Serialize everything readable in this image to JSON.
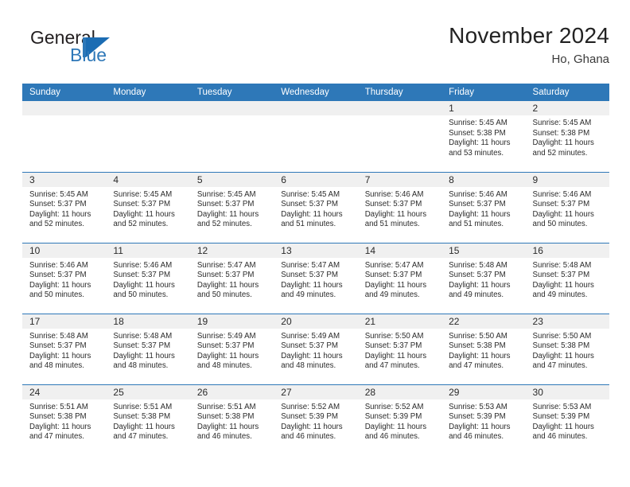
{
  "brand": {
    "word_one": "General",
    "word_two": "Blue",
    "mark": "blue-flag-triangle"
  },
  "header": {
    "title": "November 2024",
    "location": "Ho, Ghana"
  },
  "calendar": {
    "weekday_headers": [
      "Sunday",
      "Monday",
      "Tuesday",
      "Wednesday",
      "Thursday",
      "Friday",
      "Saturday"
    ],
    "colors": {
      "header_blue": "#2e78b8",
      "daynum_band_gray": "#f0f0f0",
      "row_divider": "#2e78b8",
      "text": "#2b2b2b",
      "brand_blue": "#2e78b8"
    },
    "weeks": [
      [
        {
          "day": "",
          "detail": ""
        },
        {
          "day": "",
          "detail": ""
        },
        {
          "day": "",
          "detail": ""
        },
        {
          "day": "",
          "detail": ""
        },
        {
          "day": "",
          "detail": ""
        },
        {
          "day": "1",
          "detail": "Sunrise: 5:45 AM\nSunset: 5:38 PM\nDaylight: 11 hours\nand 53 minutes."
        },
        {
          "day": "2",
          "detail": "Sunrise: 5:45 AM\nSunset: 5:38 PM\nDaylight: 11 hours\nand 52 minutes."
        }
      ],
      [
        {
          "day": "3",
          "detail": "Sunrise: 5:45 AM\nSunset: 5:37 PM\nDaylight: 11 hours\nand 52 minutes."
        },
        {
          "day": "4",
          "detail": "Sunrise: 5:45 AM\nSunset: 5:37 PM\nDaylight: 11 hours\nand 52 minutes."
        },
        {
          "day": "5",
          "detail": "Sunrise: 5:45 AM\nSunset: 5:37 PM\nDaylight: 11 hours\nand 52 minutes."
        },
        {
          "day": "6",
          "detail": "Sunrise: 5:45 AM\nSunset: 5:37 PM\nDaylight: 11 hours\nand 51 minutes."
        },
        {
          "day": "7",
          "detail": "Sunrise: 5:46 AM\nSunset: 5:37 PM\nDaylight: 11 hours\nand 51 minutes."
        },
        {
          "day": "8",
          "detail": "Sunrise: 5:46 AM\nSunset: 5:37 PM\nDaylight: 11 hours\nand 51 minutes."
        },
        {
          "day": "9",
          "detail": "Sunrise: 5:46 AM\nSunset: 5:37 PM\nDaylight: 11 hours\nand 50 minutes."
        }
      ],
      [
        {
          "day": "10",
          "detail": "Sunrise: 5:46 AM\nSunset: 5:37 PM\nDaylight: 11 hours\nand 50 minutes."
        },
        {
          "day": "11",
          "detail": "Sunrise: 5:46 AM\nSunset: 5:37 PM\nDaylight: 11 hours\nand 50 minutes."
        },
        {
          "day": "12",
          "detail": "Sunrise: 5:47 AM\nSunset: 5:37 PM\nDaylight: 11 hours\nand 50 minutes."
        },
        {
          "day": "13",
          "detail": "Sunrise: 5:47 AM\nSunset: 5:37 PM\nDaylight: 11 hours\nand 49 minutes."
        },
        {
          "day": "14",
          "detail": "Sunrise: 5:47 AM\nSunset: 5:37 PM\nDaylight: 11 hours\nand 49 minutes."
        },
        {
          "day": "15",
          "detail": "Sunrise: 5:48 AM\nSunset: 5:37 PM\nDaylight: 11 hours\nand 49 minutes."
        },
        {
          "day": "16",
          "detail": "Sunrise: 5:48 AM\nSunset: 5:37 PM\nDaylight: 11 hours\nand 49 minutes."
        }
      ],
      [
        {
          "day": "17",
          "detail": "Sunrise: 5:48 AM\nSunset: 5:37 PM\nDaylight: 11 hours\nand 48 minutes."
        },
        {
          "day": "18",
          "detail": "Sunrise: 5:48 AM\nSunset: 5:37 PM\nDaylight: 11 hours\nand 48 minutes."
        },
        {
          "day": "19",
          "detail": "Sunrise: 5:49 AM\nSunset: 5:37 PM\nDaylight: 11 hours\nand 48 minutes."
        },
        {
          "day": "20",
          "detail": "Sunrise: 5:49 AM\nSunset: 5:37 PM\nDaylight: 11 hours\nand 48 minutes."
        },
        {
          "day": "21",
          "detail": "Sunrise: 5:50 AM\nSunset: 5:37 PM\nDaylight: 11 hours\nand 47 minutes."
        },
        {
          "day": "22",
          "detail": "Sunrise: 5:50 AM\nSunset: 5:38 PM\nDaylight: 11 hours\nand 47 minutes."
        },
        {
          "day": "23",
          "detail": "Sunrise: 5:50 AM\nSunset: 5:38 PM\nDaylight: 11 hours\nand 47 minutes."
        }
      ],
      [
        {
          "day": "24",
          "detail": "Sunrise: 5:51 AM\nSunset: 5:38 PM\nDaylight: 11 hours\nand 47 minutes."
        },
        {
          "day": "25",
          "detail": "Sunrise: 5:51 AM\nSunset: 5:38 PM\nDaylight: 11 hours\nand 47 minutes."
        },
        {
          "day": "26",
          "detail": "Sunrise: 5:51 AM\nSunset: 5:38 PM\nDaylight: 11 hours\nand 46 minutes."
        },
        {
          "day": "27",
          "detail": "Sunrise: 5:52 AM\nSunset: 5:39 PM\nDaylight: 11 hours\nand 46 minutes."
        },
        {
          "day": "28",
          "detail": "Sunrise: 5:52 AM\nSunset: 5:39 PM\nDaylight: 11 hours\nand 46 minutes."
        },
        {
          "day": "29",
          "detail": "Sunrise: 5:53 AM\nSunset: 5:39 PM\nDaylight: 11 hours\nand 46 minutes."
        },
        {
          "day": "30",
          "detail": "Sunrise: 5:53 AM\nSunset: 5:39 PM\nDaylight: 11 hours\nand 46 minutes."
        }
      ]
    ]
  }
}
